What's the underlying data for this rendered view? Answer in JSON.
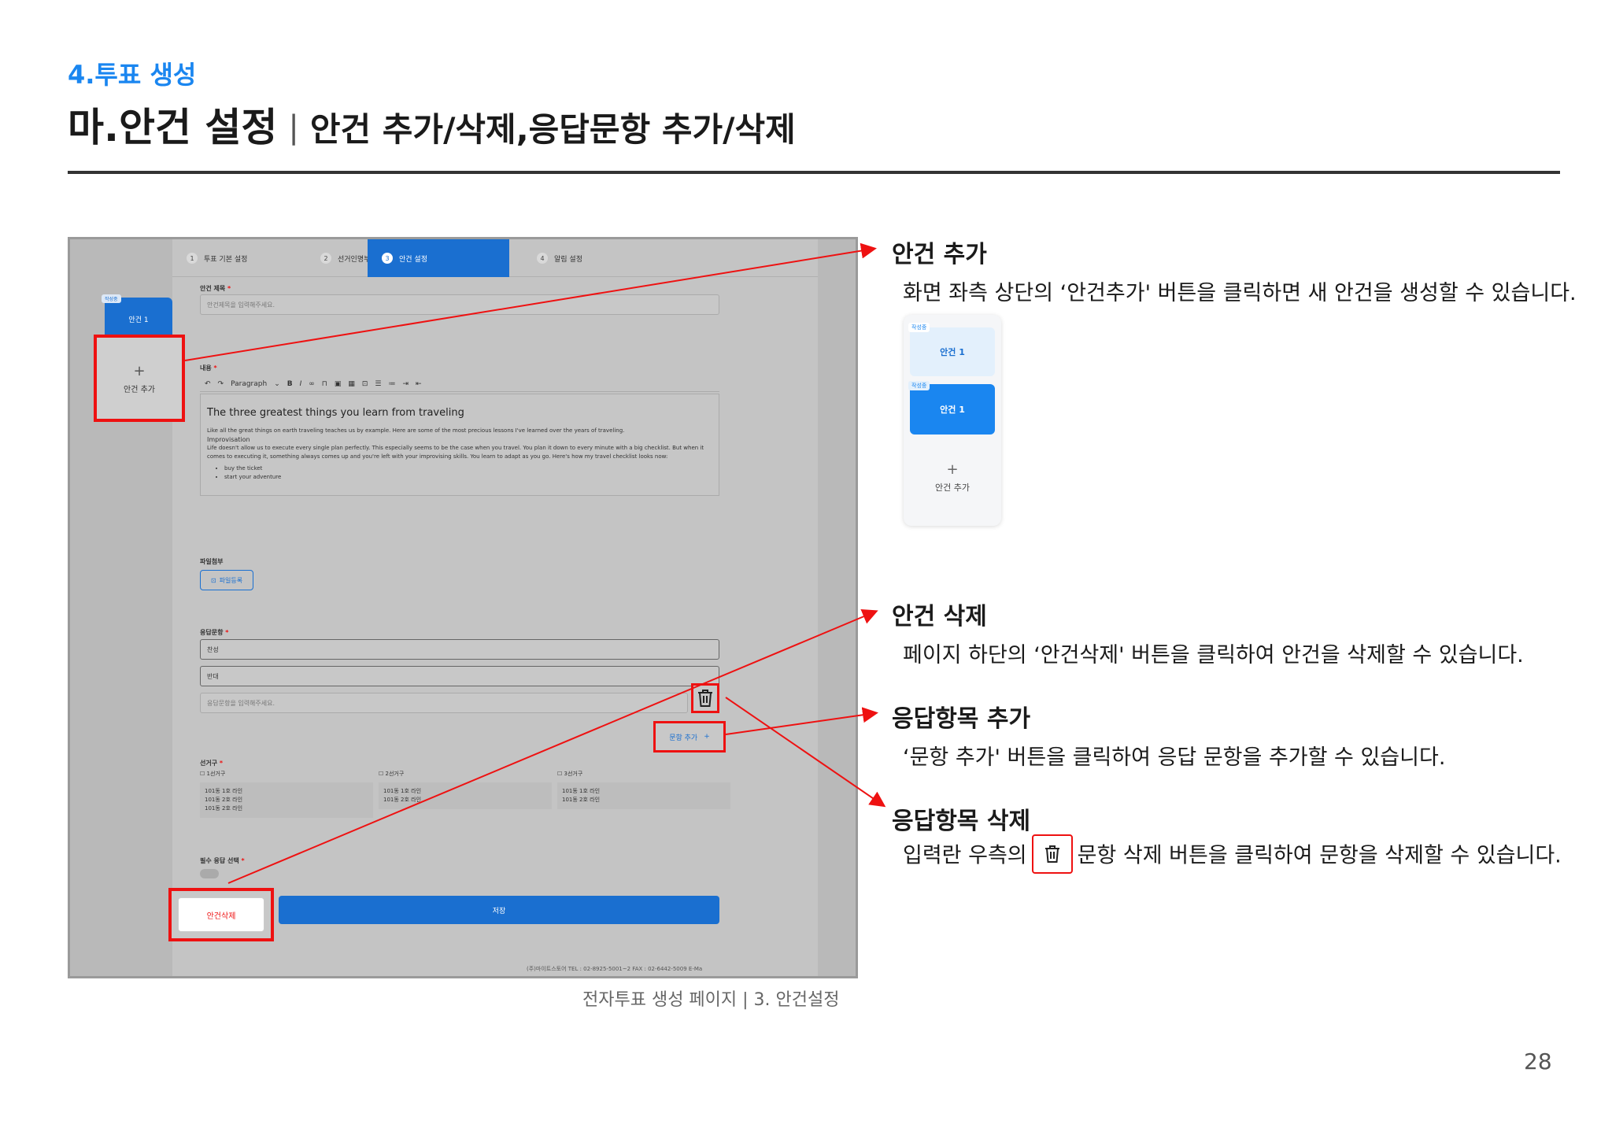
{
  "header": {
    "section_label": "4.투표 생성",
    "title_main": "마.안건 설정",
    "title_sep": "|",
    "title_sub": "안건 추가/삭제,응답문항 추가/삭제"
  },
  "screenshot": {
    "steps": [
      {
        "num": "1",
        "label": "투표 기본 설정"
      },
      {
        "num": "2",
        "label": "선거인명부 설정"
      },
      {
        "num": "3",
        "label": "안건 설정"
      },
      {
        "num": "4",
        "label": "알림 설정"
      }
    ],
    "side_badge": "작성중",
    "side_tab_label": "안건 1",
    "add_agenda_label": "안건 추가",
    "agenda_title_label": "안건 제목",
    "agenda_title_placeholder": "안건제목을 입력해주세요.",
    "content_label": "내용",
    "editor_paragraph": "Paragraph",
    "editor_heading": "The three greatest things you learn from traveling",
    "editor_para1": "Like all the great things on earth traveling teaches us by example. Here are some of the most precious lessons I've learned over the years of traveling.",
    "editor_subhead": "Improvisation",
    "editor_para2": "Life doesn't allow us to execute every single plan perfectly. This especially seems to be the case when you travel. You plan it down to every minute with a big checklist. But when it comes to executing it, something always comes up and you're left with your improvising skills. You learn to adapt as you go. Here's how my travel checklist looks now:",
    "editor_bullets": [
      "buy the ticket",
      "start your adventure"
    ],
    "file_label": "파일첨부",
    "file_button": "파일등록",
    "response_label": "응답문항",
    "response_options": [
      "찬성",
      "반대"
    ],
    "response_placeholder": "응답문항을 입력해주세요.",
    "add_question_label": "문항 추가",
    "district_label": "선거구",
    "districts": [
      {
        "name": "1선거구",
        "rows": [
          "101동  1호 라인",
          "101동  2호 라인",
          "101동  2호 라인"
        ]
      },
      {
        "name": "2선거구",
        "rows": [
          "101동  1호 라인",
          "101동  2호 라인"
        ]
      },
      {
        "name": "3선거구",
        "rows": [
          "101동  1호 라인",
          "101동  2호 라인"
        ]
      }
    ],
    "required_label": "필수 응답 선택",
    "delete_button": "안건삭제",
    "save_button": "저장",
    "footer_text": "(주)마이트스토어    TEL : 02-8925-5001~2    FAX : 02-6442-5009    E-Ma"
  },
  "caption": "전자투표 생성 페이지 | 3. 안건설정",
  "right": {
    "add": {
      "title": "안건 추가",
      "desc": "화면 좌측 상단의 ‘안건추가' 버튼을 클릭하면 새 안건을 생성할 수 있습니다."
    },
    "preview": {
      "badge1": "작성중",
      "tab1": "안건 1",
      "badge2": "작성중",
      "tab2": "안건 1",
      "add_label": "안건 추가"
    },
    "delete": {
      "title": "안건 삭제",
      "desc": "페이지 하단의 ‘안건삭제' 버튼을 클릭하여 안건을 삭제할 수 있습니다."
    },
    "add_item": {
      "title": "응답항목 추가",
      "desc": "‘문항 추가' 버튼을 클릭하여 응답 문항을 추가할 수 있습니다."
    },
    "delete_item": {
      "title": "응답항목 삭제",
      "desc_before": "입력란 우측의",
      "desc_after": "문항 삭제 버튼을 클릭하여 문항을 삭제할 수 있습니다."
    }
  },
  "page_number": "28",
  "colors": {
    "accent": "#1a86f0",
    "highlight": "#ee1111",
    "rule": "#333333"
  }
}
